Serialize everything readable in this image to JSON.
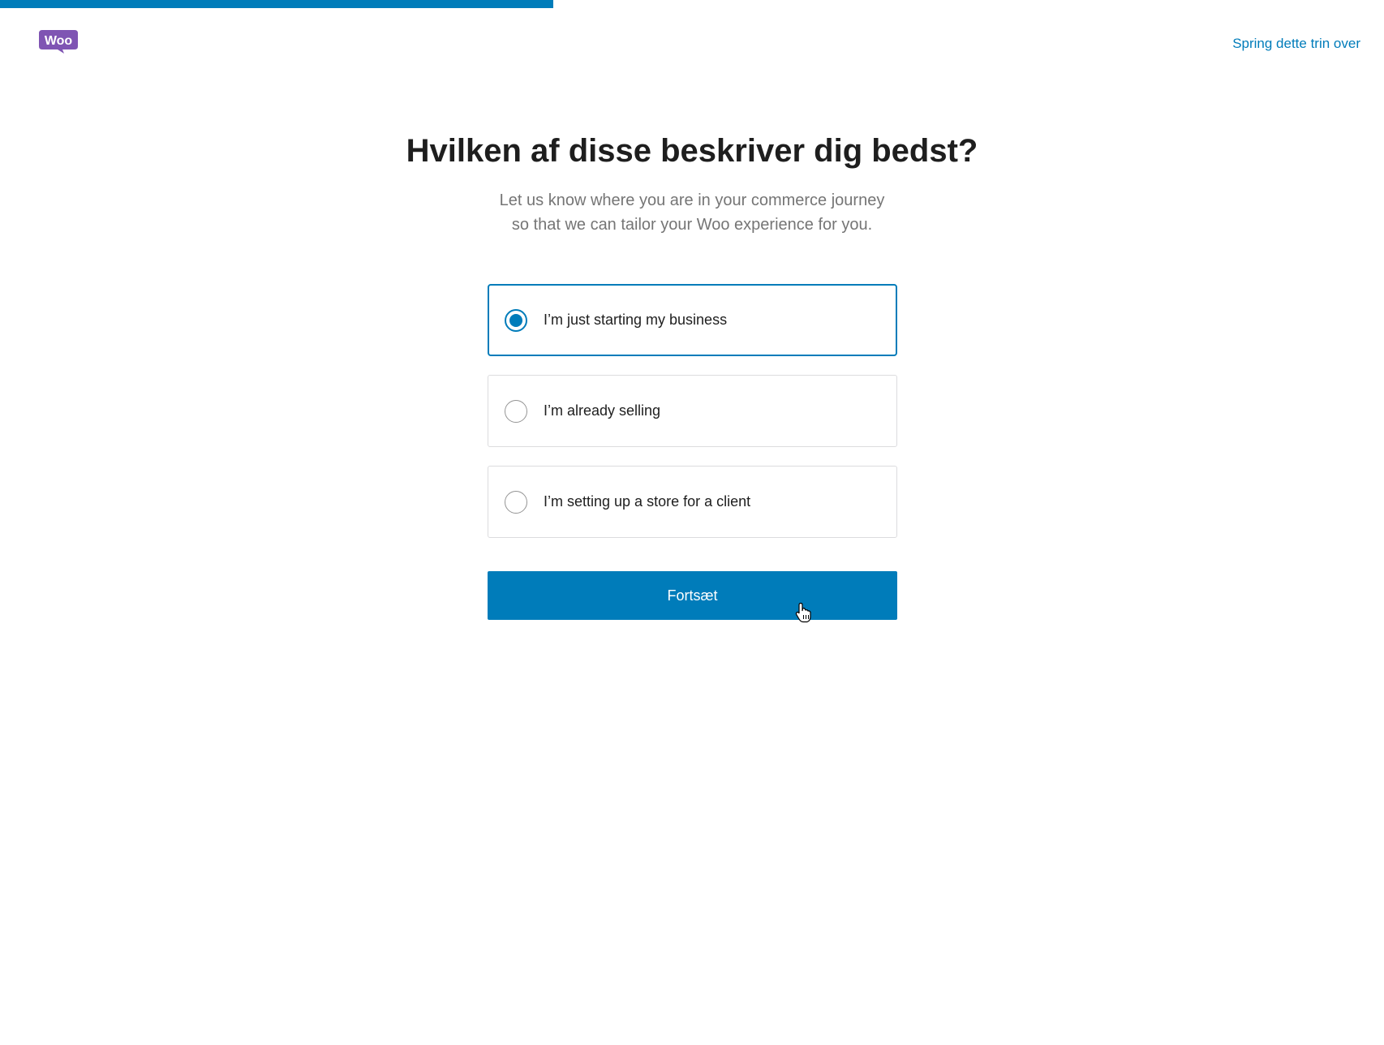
{
  "progress": {
    "percent": 40
  },
  "header": {
    "logo_text": "Woo",
    "skip_label": "Spring dette trin over"
  },
  "main": {
    "title": "Hvilken af disse beskriver dig bedst?",
    "subtitle_line1": "Let us know where you are in your commerce journey",
    "subtitle_line2": "so that we can tailor your Woo experience for you.",
    "options": [
      {
        "label": "I’m just starting my business",
        "selected": true
      },
      {
        "label": "I’m already selling",
        "selected": false
      },
      {
        "label": "I’m setting up a store for a client",
        "selected": false
      }
    ],
    "continue_label": "Fortsæt"
  },
  "colors": {
    "accent": "#007cba",
    "brand": "#7f54b3"
  },
  "icons": {
    "logo": "woo-logo-icon",
    "cursor": "hand-pointer-icon"
  }
}
